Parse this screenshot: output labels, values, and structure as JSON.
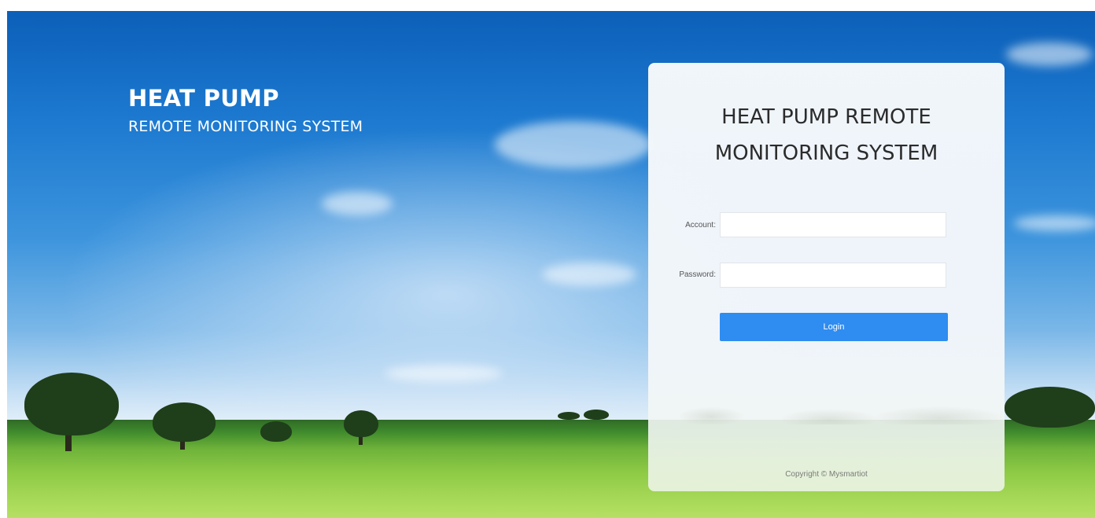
{
  "brand": {
    "title": "HEAT PUMP",
    "subtitle": "REMOTE MONITORING SYSTEM"
  },
  "login": {
    "title_line1": "HEAT PUMP REMOTE",
    "title_line2": "MONITORING SYSTEM",
    "account_label": "Account:",
    "account_value": "",
    "password_label": "Password:",
    "password_value": "",
    "login_button": "Login",
    "copyright": "Copyright © Mysmartiot"
  },
  "colors": {
    "accent": "#2f8cf0",
    "card_background": "#f6f8fa",
    "title_text": "#2b2b2b",
    "brand_text": "#ffffff"
  }
}
